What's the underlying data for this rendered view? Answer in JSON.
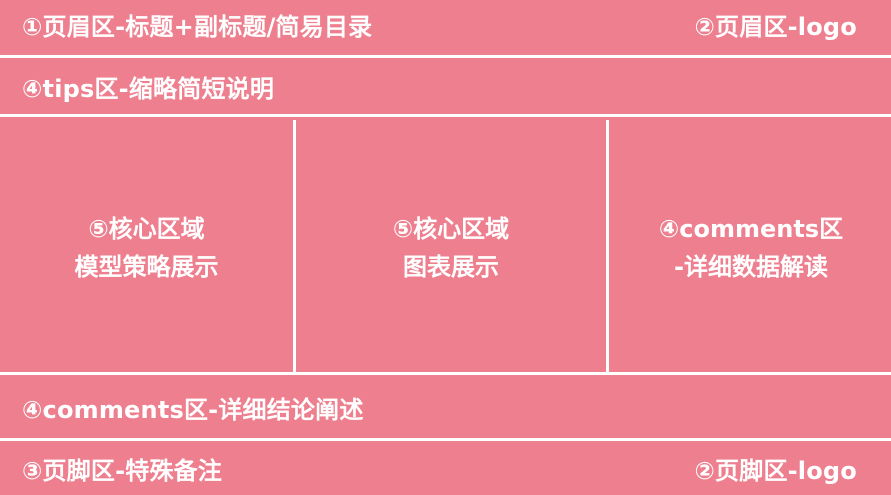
{
  "header": {
    "left": "①页眉区-标题+副标题/简易目录",
    "right": "②页眉区-logo"
  },
  "tips": {
    "label": "④tips区-缩略简短说明"
  },
  "core": {
    "cells": [
      {
        "line1": "⑤核心区域",
        "line2": "模型策略展示"
      },
      {
        "line1": "⑤核心区域",
        "line2": "图表展示"
      },
      {
        "line1": "④comments区",
        "line2": "-详细数据解读"
      }
    ]
  },
  "comments": {
    "label": "④comments区-详细结论阐述"
  },
  "footer": {
    "left": "③页脚区-特殊备注",
    "right": "②页脚区-logo"
  },
  "colors": {
    "background": "#ee7f8f",
    "divider": "#ffffff",
    "text": "#ffffff"
  }
}
